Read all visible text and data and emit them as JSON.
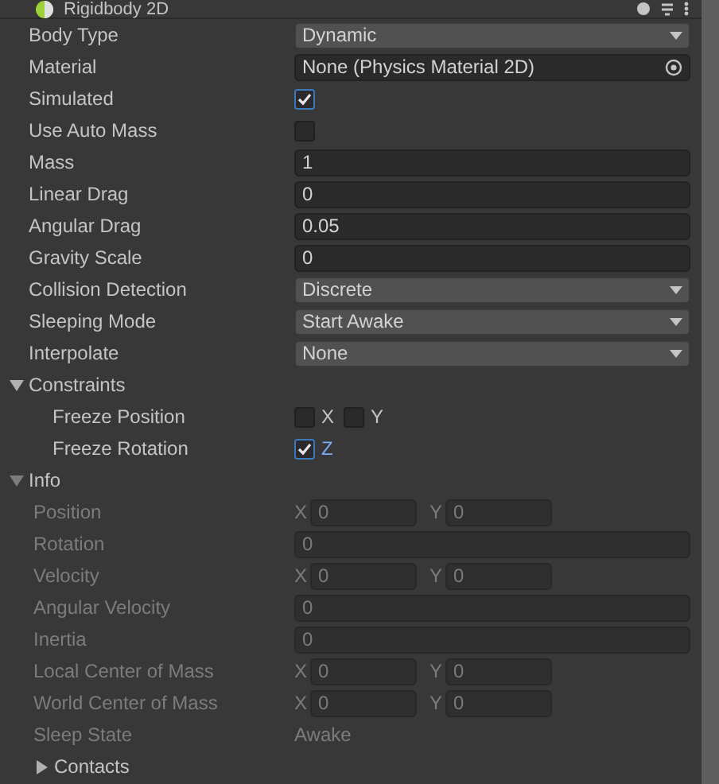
{
  "component": {
    "title": "Rigidbody 2D"
  },
  "properties": [
    {
      "kind": "dropdown",
      "label": "Body Type",
      "value": "Dynamic"
    },
    {
      "kind": "object",
      "label": "Material",
      "value": "None (Physics Material 2D)"
    },
    {
      "kind": "checkbox",
      "label": "Simulated",
      "checked": true
    },
    {
      "kind": "checkbox",
      "label": "Use Auto Mass",
      "checked": false
    },
    {
      "kind": "number",
      "label": "Mass",
      "value": "1"
    },
    {
      "kind": "number",
      "label": "Linear Drag",
      "value": "0"
    },
    {
      "kind": "number",
      "label": "Angular Drag",
      "value": "0.05"
    },
    {
      "kind": "number",
      "label": "Gravity Scale",
      "value": "0"
    },
    {
      "kind": "dropdown",
      "label": "Collision Detection",
      "value": "Discrete"
    },
    {
      "kind": "dropdown",
      "label": "Sleeping Mode",
      "value": "Start Awake"
    },
    {
      "kind": "dropdown",
      "label": "Interpolate",
      "value": "None"
    }
  ],
  "constraints": {
    "label": "Constraints",
    "expanded": true,
    "children": [
      {
        "label": "Freeze Position",
        "axes": [
          {
            "name": "X",
            "checked": false
          },
          {
            "name": "Y",
            "checked": false
          }
        ]
      },
      {
        "label": "Freeze Rotation",
        "axes": [
          {
            "name": "Z",
            "checked": true
          }
        ]
      }
    ]
  },
  "info": {
    "label": "Info",
    "expanded": true,
    "disabled": true,
    "rows": [
      {
        "kind": "vector2",
        "label": "Position",
        "components": [
          {
            "axis": "X",
            "value": "0"
          },
          {
            "axis": "Y",
            "value": "0"
          }
        ]
      },
      {
        "kind": "number",
        "label": "Rotation",
        "value": "0"
      },
      {
        "kind": "vector2",
        "label": "Velocity",
        "components": [
          {
            "axis": "X",
            "value": "0"
          },
          {
            "axis": "Y",
            "value": "0"
          }
        ]
      },
      {
        "kind": "number",
        "label": "Angular Velocity",
        "value": "0"
      },
      {
        "kind": "number",
        "label": "Inertia",
        "value": "0"
      },
      {
        "kind": "vector2",
        "label": "Local Center of Mass",
        "components": [
          {
            "axis": "X",
            "value": "0"
          },
          {
            "axis": "Y",
            "value": "0"
          }
        ]
      },
      {
        "kind": "vector2",
        "label": "World Center of Mass",
        "components": [
          {
            "axis": "X",
            "value": "0"
          },
          {
            "axis": "Y",
            "value": "0"
          }
        ]
      },
      {
        "kind": "text",
        "label": "Sleep State",
        "value": "Awake"
      },
      {
        "kind": "foldout",
        "label": "Contacts",
        "expanded": false
      }
    ]
  }
}
